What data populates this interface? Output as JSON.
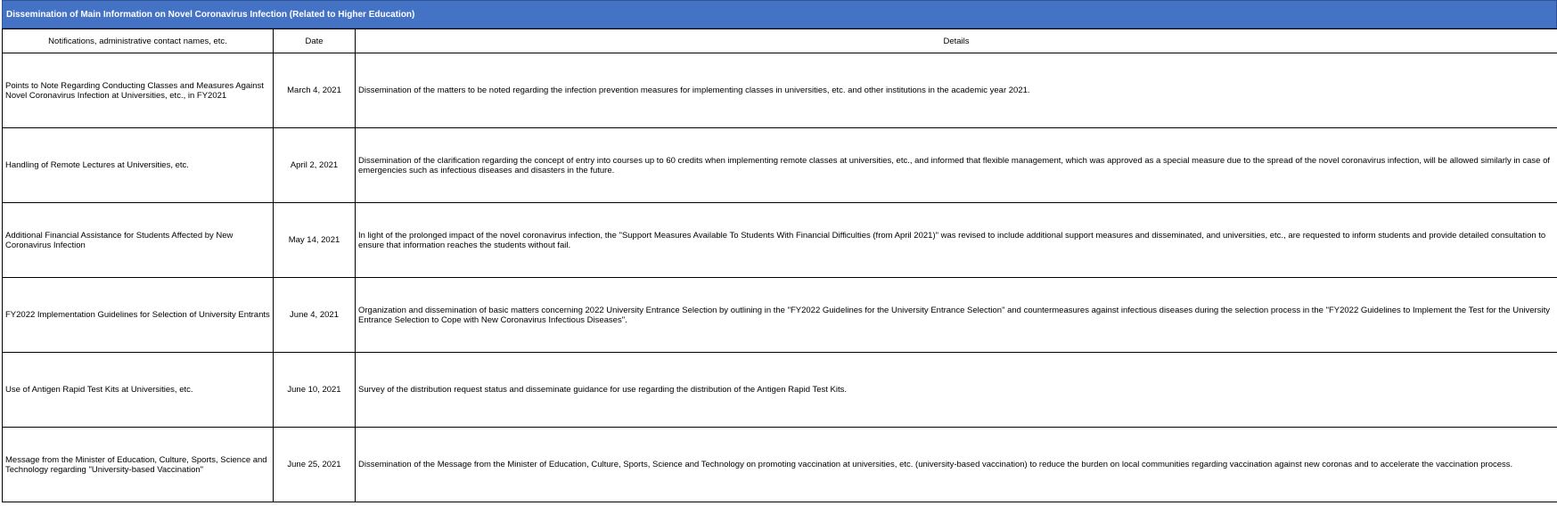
{
  "theme": {
    "header_fill": "#4472c4",
    "header_text": "#ffffff",
    "grid_line": "#000000"
  },
  "sheet": {
    "title": "Dissemination of Main Information on Novel Coronavirus Infection (Related to Higher Education)",
    "columns": {
      "notification": "Notifications, administrative contact names, etc.",
      "date": "Date",
      "details": "Details"
    },
    "rows": [
      {
        "notification": "Points to Note Regarding Conducting Classes and Measures Against Novel Coronavirus Infection at Universities, etc., in FY2021",
        "date": "March 4, 2021",
        "details": "Dissemination of the matters to be noted regarding the infection prevention measures for implementing classes in universities, etc. and other institutions in the academic year 2021."
      },
      {
        "notification": "Handling of Remote Lectures at Universities, etc.",
        "date": "April 2, 2021",
        "details": "Dissemination of the clarification regarding the concept of entry into courses up to 60 credits when implementing remote classes at universities, etc., and informed that flexible management, which was approved as a special measure due to the spread of the novel coronavirus infection, will be allowed similarly in case of emergencies such as infectious diseases and disasters in the future."
      },
      {
        "notification": "Additional Financial Assistance for Students Affected by New Coronavirus Infection",
        "date": "May 14, 2021",
        "details": "In light of the prolonged impact of the novel coronavirus infection, the \"Support Measures Available To Students With Financial Difficulties (from April 2021)\" was revised to include additional support measures and disseminated, and universities, etc., are requested to inform students and provide detailed consultation to ensure that information reaches the students without fail."
      },
      {
        "notification": "FY2022 Implementation Guidelines for Selection of University Entrants",
        "date": "June 4, 2021",
        "details": "Organization and dissemination of basic matters concerning 2022 University Entrance Selection by outlining in the \"FY2022 Guidelines for the University Entrance Selection\" and countermeasures against infectious diseases during the selection process in the \"FY2022 Guidelines to Implement the Test for the University Entrance Selection to Cope with New Coronavirus Infectious Diseases\"."
      },
      {
        "notification": "Use of Antigen Rapid Test Kits at Universities, etc.",
        "date": "June 10, 2021",
        "details": "Survey of the distribution request status and disseminate guidance for use regarding the distribution of the Antigen Rapid Test Kits."
      },
      {
        "notification": "Message from the Minister of Education, Culture, Sports, Science and Technology regarding \"University-based Vaccination\"",
        "date": "June 25, 2021",
        "details": "Dissemination of the Message from the Minister of Education, Culture, Sports, Science and Technology on promoting vaccination at universities, etc. (university-based vaccination) to reduce the burden on local communities regarding vaccination against new coronas and to accelerate the vaccination process."
      }
    ]
  }
}
